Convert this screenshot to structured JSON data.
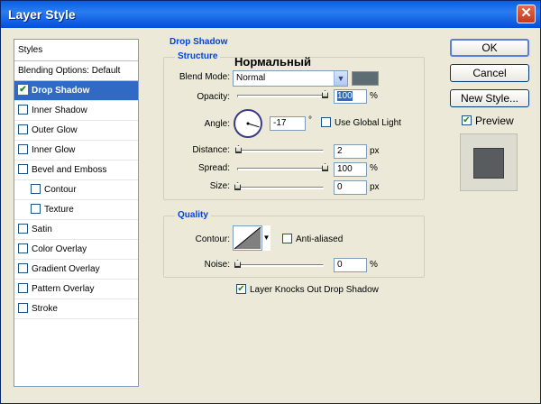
{
  "window": {
    "title": "Layer Style"
  },
  "overlay_text": "Нормальный",
  "styles_panel": {
    "header": "Styles",
    "blending": "Blending Options: Default",
    "items": [
      {
        "label": "Drop Shadow",
        "checked": true,
        "selected": true,
        "indent": false
      },
      {
        "label": "Inner Shadow",
        "checked": false,
        "selected": false,
        "indent": false
      },
      {
        "label": "Outer Glow",
        "checked": false,
        "selected": false,
        "indent": false
      },
      {
        "label": "Inner Glow",
        "checked": false,
        "selected": false,
        "indent": false
      },
      {
        "label": "Bevel and Emboss",
        "checked": false,
        "selected": false,
        "indent": false
      },
      {
        "label": "Contour",
        "checked": false,
        "selected": false,
        "indent": true
      },
      {
        "label": "Texture",
        "checked": false,
        "selected": false,
        "indent": true
      },
      {
        "label": "Satin",
        "checked": false,
        "selected": false,
        "indent": false
      },
      {
        "label": "Color Overlay",
        "checked": false,
        "selected": false,
        "indent": false
      },
      {
        "label": "Gradient Overlay",
        "checked": false,
        "selected": false,
        "indent": false
      },
      {
        "label": "Pattern Overlay",
        "checked": false,
        "selected": false,
        "indent": false
      },
      {
        "label": "Stroke",
        "checked": false,
        "selected": false,
        "indent": false
      }
    ]
  },
  "drop_shadow": {
    "section_title": "Drop Shadow",
    "structure": {
      "title": "Structure",
      "blend_mode_label": "Blend Mode:",
      "blend_mode_value": "Normal",
      "shadow_color": "#5e6d73",
      "opacity_label": "Opacity:",
      "opacity_value": "100",
      "opacity_unit": "%",
      "opacity_fraction": 1.0,
      "angle_label": "Angle:",
      "angle_value": "-17",
      "angle_unit": "°",
      "use_global_light_label": "Use Global Light",
      "use_global_light": false,
      "distance_label": "Distance:",
      "distance_value": "2",
      "distance_unit": "px",
      "distance_fraction": 0.01,
      "spread_label": "Spread:",
      "spread_value": "100",
      "spread_unit": "%",
      "spread_fraction": 1.0,
      "size_label": "Size:",
      "size_value": "0",
      "size_unit": "px",
      "size_fraction": 0.0
    },
    "quality": {
      "title": "Quality",
      "contour_label": "Contour:",
      "anti_aliased_label": "Anti-aliased",
      "anti_aliased": false,
      "noise_label": "Noise:",
      "noise_value": "0",
      "noise_unit": "%",
      "noise_fraction": 0.0
    },
    "knockout_label": "Layer Knocks Out Drop Shadow",
    "knockout": true
  },
  "buttons": {
    "ok": "OK",
    "cancel": "Cancel",
    "new_style": "New Style...",
    "preview_label": "Preview",
    "preview": true
  },
  "icons": [
    "close-icon",
    "dropdown-arrow-icon",
    "contour-curve-icon",
    "slider-thumb-icon",
    "angle-dial-icon"
  ]
}
